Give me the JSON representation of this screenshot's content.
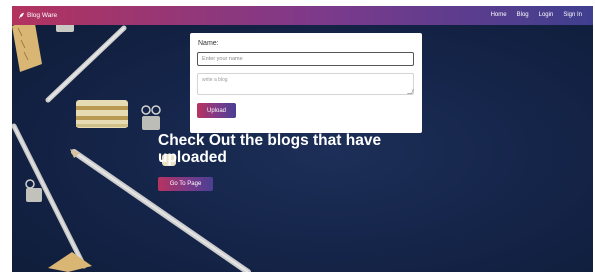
{
  "navbar": {
    "brand": "Blog Ware",
    "brand_icon": "feather-icon",
    "links": [
      {
        "label": "Home"
      },
      {
        "label": "Blog"
      },
      {
        "label": "Login"
      },
      {
        "label": "Sign In"
      }
    ],
    "gradient": [
      "#b2335f",
      "#7b3a8c",
      "#3f3f8f"
    ]
  },
  "form": {
    "name_label": "Name:",
    "name_placeholder": "Enter your name",
    "name_value": "",
    "blog_placeholder": "write a blog",
    "blog_value": "",
    "upload_label": "Upload"
  },
  "hero": {
    "title": "Check Out the blogs that have uploaded",
    "button_label": "Go To Page"
  },
  "colors": {
    "accent_start": "#b8335f",
    "accent_end": "#4a3f92",
    "background": "#142040"
  }
}
